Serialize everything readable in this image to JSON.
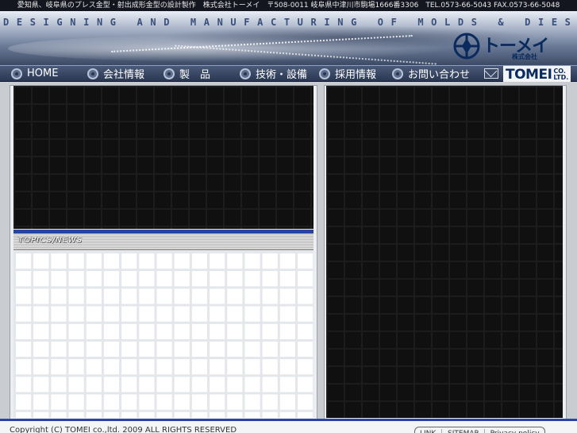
{
  "topbar": {
    "text": "愛知県、岐阜県のプレス金型・射出成形金型の設計製作　株式会社トーメイ　〒508-0011 岐阜県中津川市駒場1666番3306　TEL.0573-66-5043 FAX.0573-66-5048"
  },
  "banner": {
    "tagline": "D E S I G N I N G   A N D   M A N U F A C T U R I N G   O F   M O L D S   &   D I E S",
    "logo_name": "トーメイ",
    "logo_sub": "株式会社"
  },
  "nav": {
    "items": [
      {
        "label": "HOME"
      },
      {
        "label": "会社情報"
      },
      {
        "label": "製　品"
      },
      {
        "label": "技術・設備"
      },
      {
        "label": "採用情報"
      },
      {
        "label": "お問い合わせ"
      }
    ],
    "brand_name": "TOMEI",
    "brand_co": "CO.",
    "brand_ltd": "LTD."
  },
  "topics": {
    "title": "TOPICS/NEWS"
  },
  "footer": {
    "copyright": "Copyright (C) TOMEI co.,ltd. 2009 ALL RIGHTS RESERVED",
    "links": "LINK  ｜  SITEMAP  ｜  Privacy policy"
  },
  "colors": {
    "accent_blue": "#2b44a4",
    "nav_bg": "#2b3752",
    "panel_black": "#101010"
  }
}
